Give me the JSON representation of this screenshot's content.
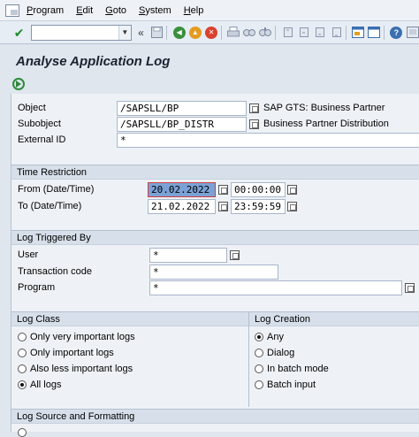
{
  "menu": {
    "items": [
      "Program",
      "Edit",
      "Goto",
      "System",
      "Help"
    ]
  },
  "page": {
    "title": "Analyse Application Log"
  },
  "main": {
    "object": {
      "label": "Object",
      "value": "/SAPSLL/BP",
      "description": "SAP GTS: Business Partner"
    },
    "subobject": {
      "label": "Subobject",
      "value": "/SAPSLL/BP_DISTR",
      "description": "Business Partner Distribution"
    },
    "external_id": {
      "label": "External ID",
      "value": "*"
    }
  },
  "time_restriction": {
    "title": "Time Restriction",
    "from": {
      "label": "From (Date/Time)",
      "date": "20.02.2022",
      "time": "00:00:00"
    },
    "to": {
      "label": "To (Date/Time)",
      "date": "21.02.2022",
      "time": "23:59:59"
    }
  },
  "log_triggered_by": {
    "title": "Log Triggered By",
    "user": {
      "label": "User",
      "value": "*"
    },
    "transaction": {
      "label": "Transaction code",
      "value": "*"
    },
    "program": {
      "label": "Program",
      "value": "*"
    }
  },
  "log_class": {
    "title": "Log Class",
    "options": [
      "Only very important logs",
      "Only important logs",
      "Also less important logs",
      "All logs"
    ],
    "selected": "All logs"
  },
  "log_creation": {
    "title": "Log Creation",
    "options": [
      "Any",
      "Dialog",
      "In batch mode",
      "Batch input"
    ],
    "selected": "Any"
  },
  "log_source": {
    "title": "Log Source and Formatting"
  }
}
